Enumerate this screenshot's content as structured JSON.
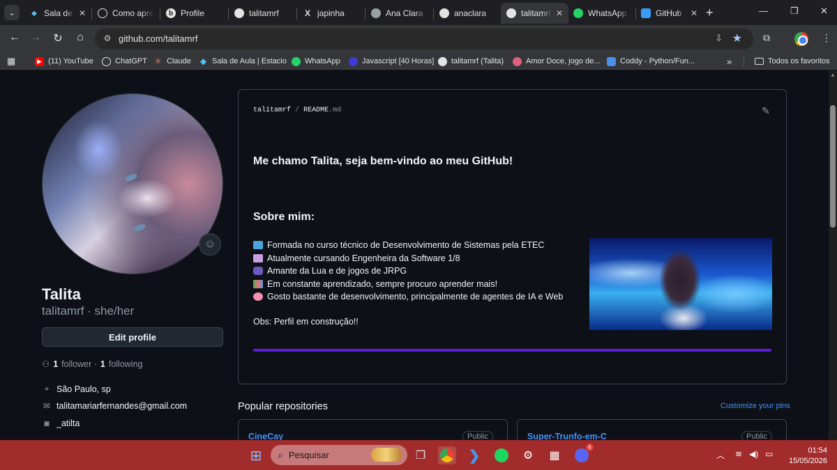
{
  "browser": {
    "tabs": [
      {
        "title": "Sala de Aula | Estacio",
        "icon": "diamond-icon",
        "color": "#4fc3f7"
      },
      {
        "title": "Como aprender",
        "icon": "chatgpt-icon",
        "color": "#e3e3e3"
      },
      {
        "title": "Profile",
        "icon": "b-icon",
        "color": "#e3e3e3"
      },
      {
        "title": "talitamrf",
        "icon": "github-icon",
        "color": "#e3e3e3"
      },
      {
        "title": "japinha",
        "icon": "x-icon",
        "color": "#e3e3e3"
      },
      {
        "title": "Ana Clara",
        "icon": "globe-icon",
        "color": "#e3e3e3"
      },
      {
        "title": "anaclara",
        "icon": "github-icon",
        "color": "#e3e3e3"
      },
      {
        "title": "talitamrf",
        "icon": "github-icon",
        "color": "#e3e3e3",
        "active": true
      },
      {
        "title": "WhatsApp",
        "icon": "whatsapp-icon",
        "color": "#25d366"
      },
      {
        "title": "GitHub",
        "icon": "vscode-icon",
        "color": "#3b9cf5"
      }
    ],
    "url": "github.com/talitamrf",
    "bookmarks": [
      {
        "label": "(11) YouTube",
        "icon": "youtube-icon",
        "color": "#ff0000"
      },
      {
        "label": "ChatGPT",
        "icon": "chatgpt-icon",
        "color": "#e3e3e3"
      },
      {
        "label": "Claude",
        "icon": "claude-icon",
        "color": "#d97757"
      },
      {
        "label": "Sala de Aula | Estacio",
        "icon": "diamond-icon",
        "color": "#4fc3f7"
      },
      {
        "label": "WhatsApp",
        "icon": "whatsapp-icon",
        "color": "#25d366"
      },
      {
        "label": "Javascript [40 Horas]",
        "icon": "dot-icon",
        "color": "#3d3dd6"
      },
      {
        "label": "talitamrf (Talita)",
        "icon": "github-icon",
        "color": "#e3e3e3"
      },
      {
        "label": "Amor Doce, jogo de...",
        "icon": "game-icon",
        "color": "#e06080"
      },
      {
        "label": "Coddy - Python/Fun...",
        "icon": "coddy-icon",
        "color": "#4a8fe8"
      }
    ],
    "bookmarks_more": "»",
    "all_favorites": "Todos os favoritos"
  },
  "profile": {
    "name": "Talita",
    "login": "talitamrf · she/her",
    "edit_button": "Edit profile",
    "followers_count": "1",
    "followers_label": "follower ·",
    "following_count": "1",
    "following_label": "following",
    "location": "São Paulo, sp",
    "email": "talitamariarfernandes@gmail.com",
    "instagram": "_atilta"
  },
  "readme": {
    "owner": "talitamrf",
    "sep": "/",
    "file": "README",
    "ext": ".md",
    "heading": "Me chamo Talita, seja bem-vindo ao meu GitHub!",
    "about_heading": "Sobre mim:",
    "items": [
      {
        "emoji": "laptop-emoji",
        "text": "Formada no curso técnico de Desenvolvimento de Sistemas pela ETEC"
      },
      {
        "emoji": "school-emoji",
        "text": "Atualmente cursando Engenheira da Software 1/8"
      },
      {
        "emoji": "gamepad-emoji",
        "text": "Amante da Lua e de jogos de JRPG"
      },
      {
        "emoji": "books-emoji",
        "text": "Em constante aprendizado, sempre procuro aprender mais!"
      },
      {
        "emoji": "brain-emoji",
        "text": "Gosto bastante de desenvolvimento, principalmente de agentes de IA e Web"
      }
    ],
    "note": "Obs: Perfil em construção!!",
    "accent_bar_color": "#5f1bd8"
  },
  "popular": {
    "title": "Popular repositories",
    "customize": "Customize your pins",
    "repos": [
      {
        "name": "CineCay",
        "visibility": "Public"
      },
      {
        "name": "Super-Trunfo-em-C",
        "visibility": "Public"
      }
    ]
  },
  "taskbar": {
    "search_placeholder": "Pesquisar",
    "time": "01:54",
    "date": "15/05/2026",
    "discord_badge": "6",
    "color": "#a22b2b"
  }
}
